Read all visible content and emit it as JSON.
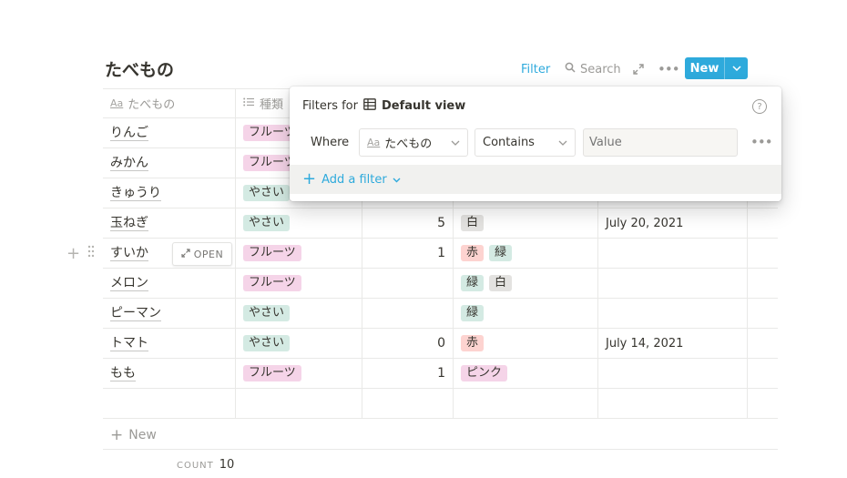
{
  "page": {
    "title": "たべもの"
  },
  "toolbar": {
    "filter_label": "Filter",
    "search_label": "Search",
    "new_label": "New"
  },
  "table": {
    "columns": [
      "たべもの",
      "種類"
    ],
    "rows": [
      {
        "name": "りんご",
        "kind": "フルーツ",
        "num": "",
        "colors": [],
        "date": ""
      },
      {
        "name": "みかん",
        "kind": "フルーツ",
        "num": "",
        "colors": [],
        "date": ""
      },
      {
        "name": "きゅうり",
        "kind": "やさい",
        "num": "",
        "colors": [],
        "date": ""
      },
      {
        "name": "玉ねぎ",
        "kind": "やさい",
        "num": "5",
        "colors": [
          "白"
        ],
        "date": "July 20, 2021"
      },
      {
        "name": "すいか",
        "kind": "フルーツ",
        "num": "1",
        "colors": [
          "赤",
          "緑"
        ],
        "date": ""
      },
      {
        "name": "メロン",
        "kind": "フルーツ",
        "num": "",
        "colors": [
          "緑",
          "白"
        ],
        "date": ""
      },
      {
        "name": "ピーマン",
        "kind": "やさい",
        "num": "",
        "colors": [
          "緑"
        ],
        "date": ""
      },
      {
        "name": "トマト",
        "kind": "やさい",
        "num": "0",
        "colors": [
          "赤"
        ],
        "date": "July 14, 2021"
      },
      {
        "name": "もも",
        "kind": "フルーツ",
        "num": "1",
        "colors": [
          "ピンク"
        ],
        "date": ""
      }
    ],
    "open_label": "OPEN",
    "new_row_label": "New",
    "count_label": "COUNT",
    "count_value": "10"
  },
  "filter_popover": {
    "header_prefix": "Filters for",
    "view_name": "Default view",
    "where_label": "Where",
    "property": "たべもの",
    "operator": "Contains",
    "value_placeholder": "Value",
    "add_filter_label": "Add a filter"
  },
  "colors": {
    "accent": "#2eaadc",
    "tag_fruit": "#f5d4e8",
    "tag_veg": "#d4eae3",
    "tag_red": "#fdd3d0",
    "tag_white": "#e3e2e0"
  },
  "icons": [
    "search-icon",
    "expand-icon",
    "more-icon",
    "chevron-down-icon",
    "text-property-icon",
    "list-property-icon",
    "table-icon",
    "help-icon",
    "plus-icon",
    "drag-handle-icon"
  ]
}
